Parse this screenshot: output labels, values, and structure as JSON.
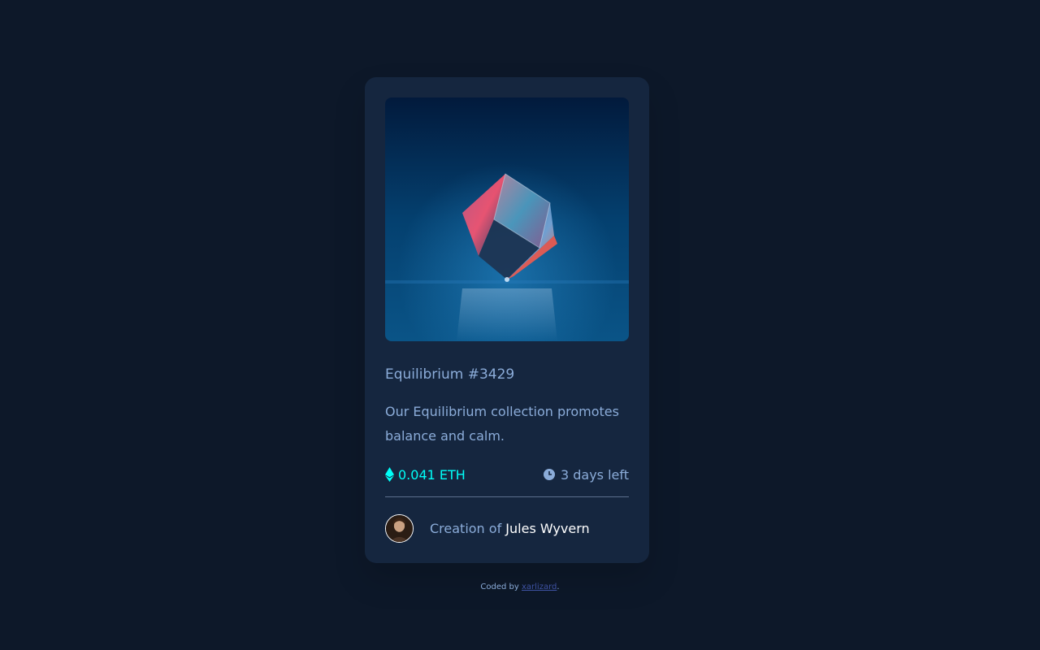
{
  "card": {
    "title": "Equilibrium #3429",
    "description": "Our Equilibrium collection promotes balance and calm.",
    "price": "0.041 ETH",
    "time_left": "3 days left",
    "creator_prefix": "Creation of ",
    "creator_name": "Jules Wyvern"
  },
  "icons": {
    "price": "ethereum-icon",
    "time": "clock-icon"
  },
  "attribution": {
    "prefix": "Coded by ",
    "author": "xarlizard",
    "suffix": "."
  },
  "colors": {
    "background": "#0d1829",
    "card": "#15263f",
    "soft_blue": "#8bacd9",
    "cyan": "#00fff8",
    "white": "#ffffff",
    "link": "#3e52a3"
  }
}
